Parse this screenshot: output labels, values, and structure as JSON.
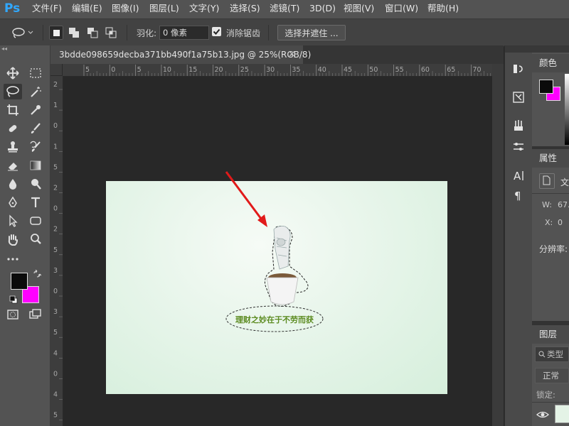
{
  "app": {
    "logo": "Ps"
  },
  "menu": [
    "文件(F)",
    "编辑(E)",
    "图像(I)",
    "图层(L)",
    "文字(Y)",
    "选择(S)",
    "滤镜(T)",
    "3D(D)",
    "视图(V)",
    "窗口(W)",
    "帮助(H)"
  ],
  "options": {
    "feather_label": "羽化:",
    "feather_value": "0 像素",
    "antialias_label": "消除锯齿",
    "select_mask_button": "选择并遮住 ..."
  },
  "document": {
    "tab_title": "3bdde098659decba371bb490f1a75b13.jpg @ 25%(RGB/8)",
    "close_glyph": "×",
    "canvas_caption": "理财之妙在于不劳而获"
  },
  "ruler_top": [
    "5",
    "0",
    "5",
    "10",
    "15",
    "20",
    "25",
    "30",
    "35",
    "40",
    "45",
    "50",
    "55",
    "60",
    "65",
    "70"
  ],
  "ruler_left": [
    "2",
    "1",
    "0",
    "1",
    "5",
    "2",
    "0",
    "2",
    "5",
    "3",
    "0",
    "3",
    "5",
    "4",
    "0",
    "4",
    "5"
  ],
  "panels": {
    "color_tab": "颜色",
    "properties_tab": "属性",
    "properties_doc_partial": "文",
    "w_label": "W:",
    "w_value": "67.",
    "x_label": "X:",
    "x_value": "0",
    "resolution_label": "分辨率:",
    "layers_tab": "图层",
    "layers_search_placeholder": "类型",
    "blend_mode": "正常",
    "lock_label": "锁定:"
  },
  "colors": {
    "foreground": "#0b0b0b",
    "background": "#ff00ff",
    "accent": "#31a8ff",
    "arrow": "#e11a1a",
    "caption_green": "#5a8a1e"
  }
}
